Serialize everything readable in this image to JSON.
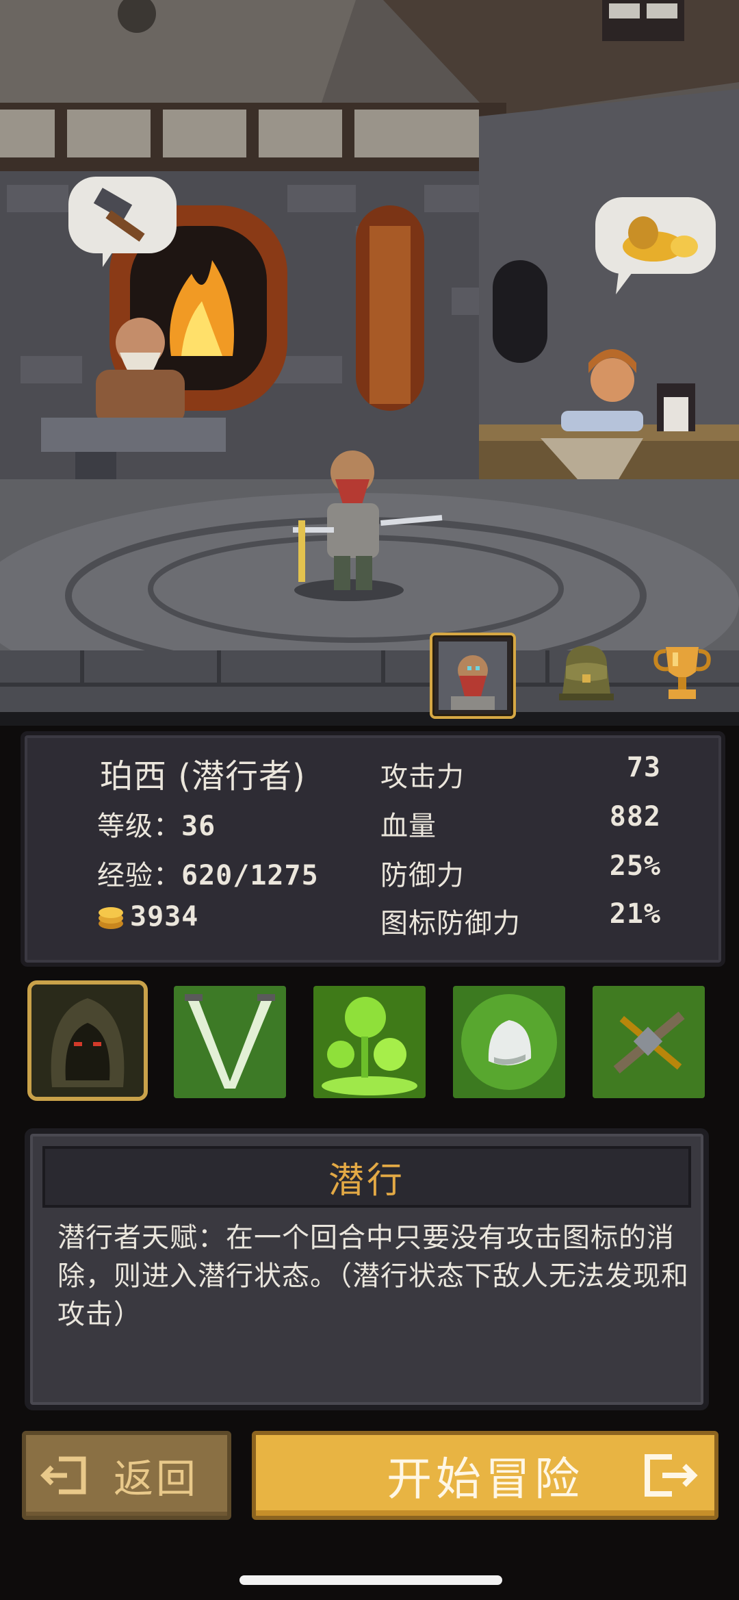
{
  "tabs": [
    {
      "name": "hero",
      "icon": "hero-portrait-icon",
      "active": true
    },
    {
      "name": "bag",
      "icon": "backpack-icon",
      "active": false
    },
    {
      "name": "trophy",
      "icon": "trophy-icon",
      "active": false
    }
  ],
  "hero": {
    "name": "珀西 (潜行者)",
    "level_label": "等级：",
    "level": "36",
    "exp_label": "经验：",
    "exp": "620/1275",
    "gold": "3934"
  },
  "attributes": [
    {
      "label": "攻击力",
      "value": "73"
    },
    {
      "label": "血量",
      "value": "882"
    },
    {
      "label": "防御力",
      "value": "25%"
    },
    {
      "label": "图标防御力",
      "value": "21%"
    }
  ],
  "skills": [
    {
      "icon": "hooded-rogue-icon",
      "selected": true
    },
    {
      "icon": "crossed-blades-icon",
      "selected": false
    },
    {
      "icon": "green-bubbles-icon",
      "selected": false
    },
    {
      "icon": "green-stone-icon",
      "selected": false
    },
    {
      "icon": "crossbow-icon",
      "selected": false
    }
  ],
  "description": {
    "title": "潜行",
    "text": "潜行者天赋：在一个回合中只要没有攻击图标的消除，则进入潜行状态。（潜行状态下敌人无法发现和攻击）"
  },
  "buttons": {
    "back": "返回",
    "start": "开始冒险"
  }
}
